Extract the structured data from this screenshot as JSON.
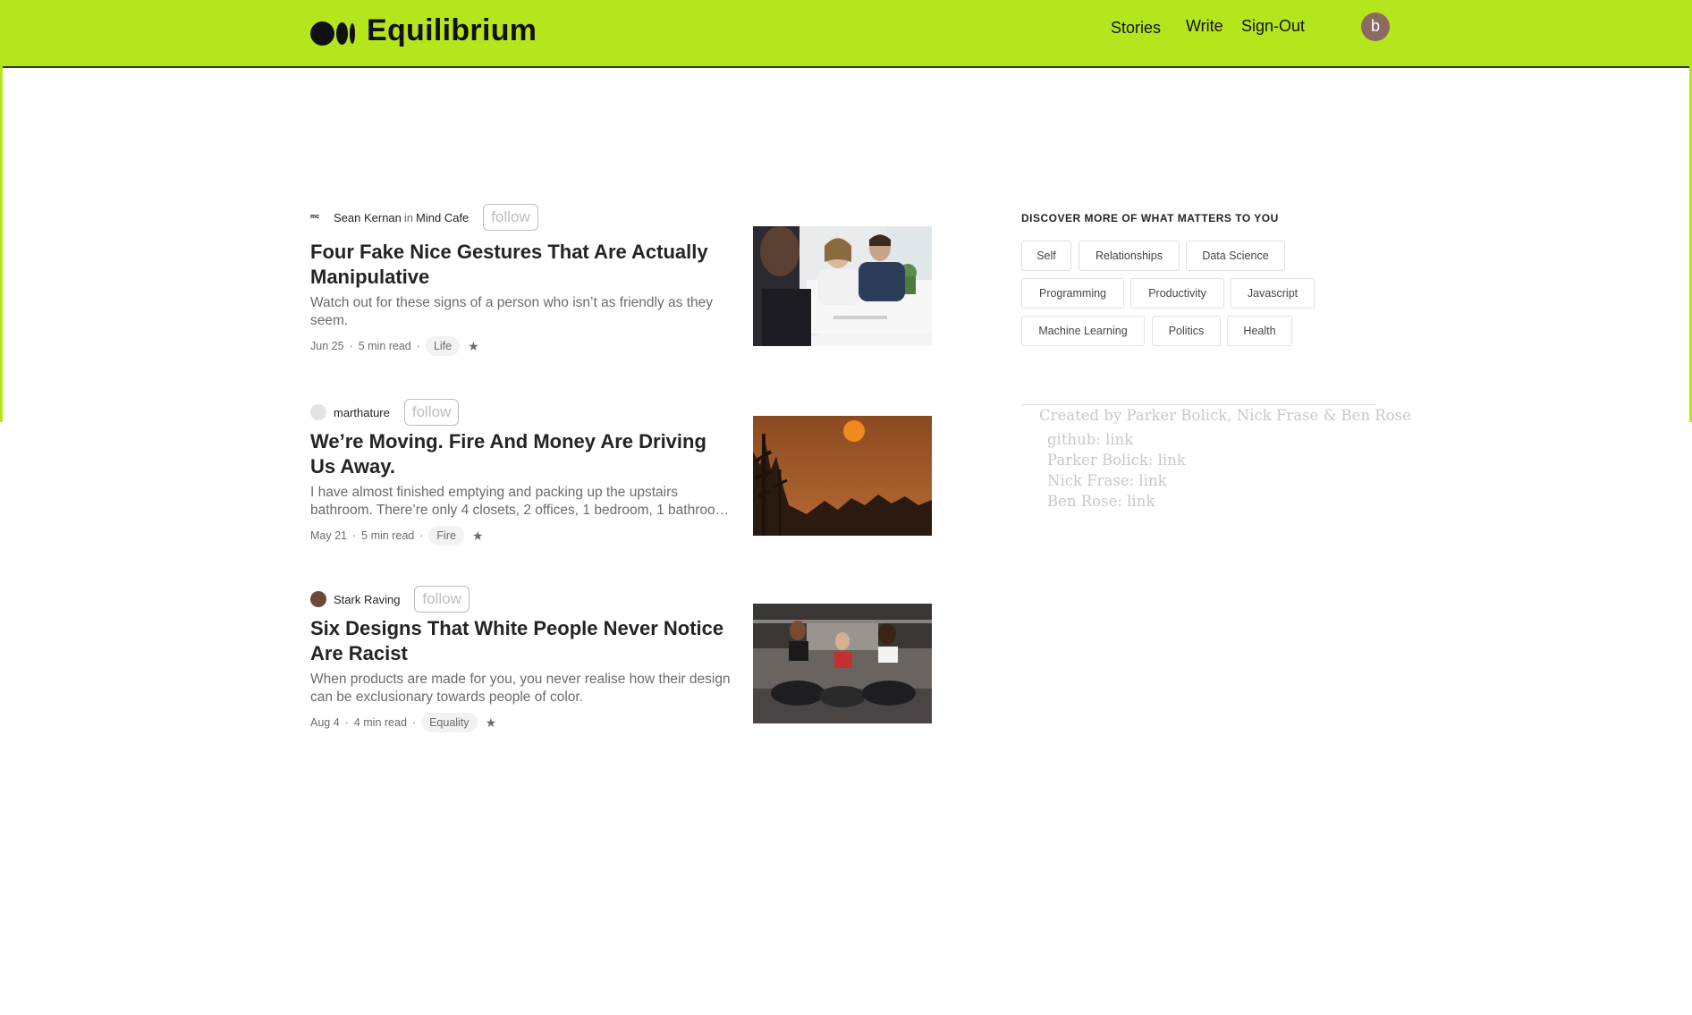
{
  "header": {
    "brand": "Equilibrium",
    "nav": {
      "stories": "Stories",
      "write": "Write",
      "signout": "Sign-Out"
    },
    "avatar_letter": "b",
    "bar_color": "#b5e61d"
  },
  "articles": [
    {
      "author": "Sean Kernan",
      "in": "in",
      "publication": "Mind Cafe",
      "publication_logo": "mc",
      "follow": "follow",
      "title": "Four Fake Nice Gestures That Are Actually Manipulative",
      "subtitle": "Watch out for these signs of a person who isn’t as friendly as they seem.",
      "date": "Jun 25",
      "read_time": "5 min read",
      "tag": "Life",
      "thumbnail": "office meeting photo"
    },
    {
      "author": "marthature",
      "follow": "follow",
      "title": "We’re Moving. Fire And Money Are Driving Us Away.",
      "subtitle": "I have almost finished emptying and packing up the upstairs bathroom. There’re only 4 closets, 2 offices, 1 bedroom, 1 bathroo…",
      "date": "May 21",
      "read_time": "5 min read",
      "tag": "Fire",
      "thumbnail": "smoky orange sky with trees photo"
    },
    {
      "author": "Stark Raving",
      "follow": "follow",
      "title": "Six Designs That White People Never Notice Are Racist",
      "subtitle": "When products are made for you, you never realise how their design can be exclusionary towards people of color.",
      "date": "Aug 4",
      "read_time": "4 min read",
      "tag": "Equality",
      "thumbnail": "three women sitting in gym photo"
    }
  ],
  "meta_separator": "·",
  "star": "★",
  "sidebar": {
    "heading": "DISCOVER MORE OF WHAT MATTERS TO YOU",
    "topics": [
      "Self",
      "Relationships",
      "Data Science",
      "Programming",
      "Productivity",
      "Javascript",
      "Machine Learning",
      "Politics",
      "Health"
    ]
  },
  "footer": {
    "credit": "Created by Parker Bolick, Nick Frase & Ben Rose",
    "links": [
      "github: link",
      "Parker Bolick: link",
      "Nick Frase: link",
      "Ben Rose: link"
    ]
  }
}
